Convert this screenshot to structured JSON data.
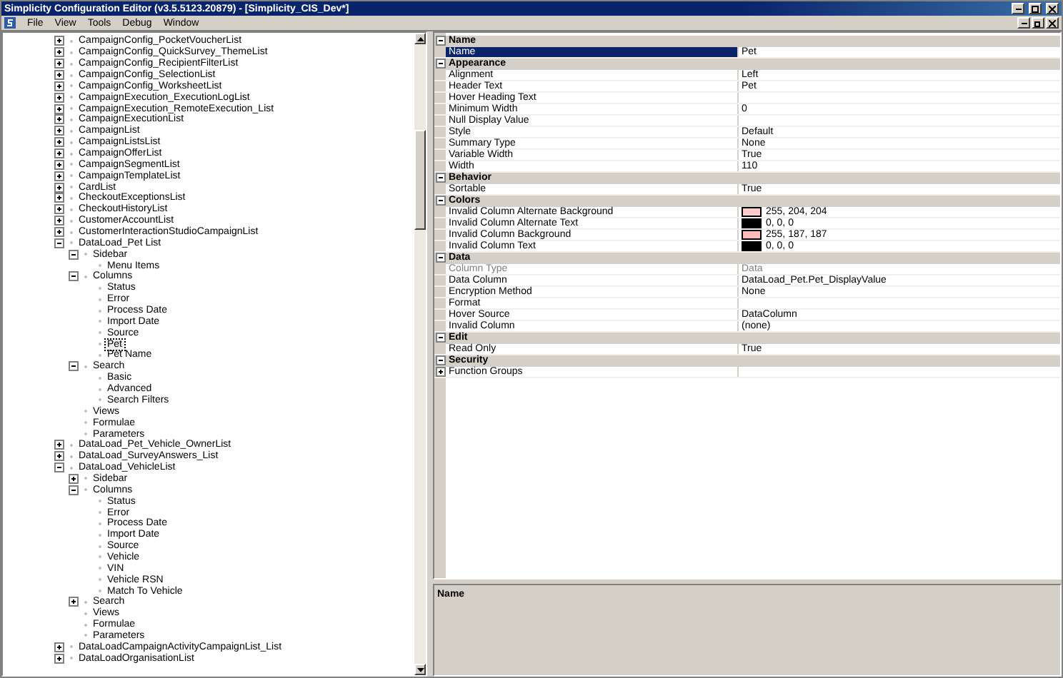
{
  "window": {
    "title": "Simplicity Configuration Editor (v3.5.5123.20879) - [Simplicity_CIS_Dev*]"
  },
  "menu": [
    "File",
    "View",
    "Tools",
    "Debug",
    "Window"
  ],
  "tree": [
    {
      "label": "CampaignConfig_PocketVoucherList",
      "selected": false,
      "expanded": false
    },
    {
      "label": "CampaignConfig_QuickSurvey_ThemeList",
      "selected": false,
      "expanded": false
    },
    {
      "label": "CampaignConfig_RecipientFilterList",
      "selected": false,
      "expanded": false
    },
    {
      "label": "CampaignConfig_SelectionList",
      "selected": false,
      "expanded": false
    },
    {
      "label": "CampaignConfig_WorksheetList",
      "selected": false,
      "expanded": false
    },
    {
      "label": "CampaignExecution_ExecutionLogList",
      "selected": false,
      "expanded": false
    },
    {
      "label": "CampaignExecution_RemoteExecution_List",
      "selected": false,
      "expanded": false
    },
    {
      "label": "CampaignExecutionList",
      "selected": false,
      "expanded": false
    },
    {
      "label": "CampaignList",
      "selected": false,
      "expanded": false
    },
    {
      "label": "CampaignListsList",
      "selected": false,
      "expanded": false
    },
    {
      "label": "CampaignOfferList",
      "selected": false,
      "expanded": false
    },
    {
      "label": "CampaignSegmentList",
      "selected": false,
      "expanded": false
    },
    {
      "label": "CampaignTemplateList",
      "selected": false,
      "expanded": false
    },
    {
      "label": "CardList",
      "selected": false,
      "expanded": false
    },
    {
      "label": "CheckoutExceptionsList",
      "selected": false,
      "expanded": false
    },
    {
      "label": "CheckoutHistoryList",
      "selected": false,
      "expanded": false
    },
    {
      "label": "CustomerAccountList",
      "selected": false,
      "expanded": false
    },
    {
      "label": "CustomerInteractionStudioCampaignList",
      "selected": false,
      "expanded": false
    },
    {
      "label": "DataLoad_Pet List",
      "selected": false,
      "expanded": true,
      "children": [
        {
          "label": "Sidebar",
          "selected": false,
          "expanded": true,
          "children": [
            {
              "label": "Menu Items",
              "selected": false
            }
          ]
        },
        {
          "label": "Columns",
          "selected": false,
          "expanded": true,
          "children": [
            {
              "label": "Status",
              "selected": false
            },
            {
              "label": "Error",
              "selected": false
            },
            {
              "label": "Process Date",
              "selected": false
            },
            {
              "label": "Import Date",
              "selected": false
            },
            {
              "label": "Source",
              "selected": false
            },
            {
              "label": "Pet",
              "selected": true
            },
            {
              "label": "Pet Name",
              "selected": false
            }
          ]
        },
        {
          "label": "Search",
          "selected": false,
          "expanded": true,
          "children": [
            {
              "label": "Basic",
              "selected": false
            },
            {
              "label": "Advanced",
              "selected": false
            },
            {
              "label": "Search Filters",
              "selected": false
            }
          ]
        },
        {
          "label": "Views",
          "selected": false
        },
        {
          "label": "Formulae",
          "selected": false
        },
        {
          "label": "Parameters",
          "selected": false
        }
      ]
    },
    {
      "label": "DataLoad_Pet_Vehicle_OwnerList",
      "selected": false,
      "expanded": false
    },
    {
      "label": "DataLoad_SurveyAnswers_List",
      "selected": false,
      "expanded": false
    },
    {
      "label": "DataLoad_VehicleList",
      "selected": false,
      "expanded": true,
      "children": [
        {
          "label": "Sidebar",
          "selected": false,
          "expanded": false
        },
        {
          "label": "Columns",
          "selected": false,
          "expanded": true,
          "children": [
            {
              "label": "Status",
              "selected": false
            },
            {
              "label": "Error",
              "selected": false
            },
            {
              "label": "Process Date",
              "selected": false
            },
            {
              "label": "Import Date",
              "selected": false
            },
            {
              "label": "Source",
              "selected": false
            },
            {
              "label": "Vehicle",
              "selected": false
            },
            {
              "label": "VIN",
              "selected": false
            },
            {
              "label": "Vehicle RSN",
              "selected": false
            },
            {
              "label": "Match To Vehicle",
              "selected": false
            }
          ]
        },
        {
          "label": "Search",
          "selected": false,
          "expanded": false
        },
        {
          "label": "Views",
          "selected": false
        },
        {
          "label": "Formulae",
          "selected": false
        },
        {
          "label": "Parameters",
          "selected": false
        }
      ]
    },
    {
      "label": "DataLoadCampaignActivityCampaignList_List",
      "selected": false,
      "expanded": false
    },
    {
      "label": "DataLoadOrganisationList",
      "selected": false,
      "expanded": false
    }
  ],
  "properties": [
    {
      "category": "Name",
      "expanded": true,
      "rows": [
        {
          "kind": "value",
          "name": "Name",
          "value": "Pet",
          "selected": true,
          "disabled": false
        }
      ]
    },
    {
      "category": "Appearance",
      "expanded": true,
      "rows": [
        {
          "kind": "value",
          "name": "Alignment",
          "value": "Left",
          "selected": false,
          "disabled": false
        },
        {
          "kind": "value",
          "name": "Header Text",
          "value": "Pet",
          "selected": false,
          "disabled": false
        },
        {
          "kind": "value",
          "name": "Hover Heading Text",
          "selected": false,
          "disabled": false
        },
        {
          "kind": "value",
          "name": "Minimum Width",
          "value": "0",
          "selected": false,
          "disabled": false
        },
        {
          "kind": "value",
          "name": "Null Display Value",
          "selected": false,
          "disabled": false
        },
        {
          "kind": "value",
          "name": "Style",
          "value": "Default",
          "selected": false,
          "disabled": false
        },
        {
          "kind": "value",
          "name": "Summary Type",
          "value": "None",
          "selected": false,
          "disabled": false
        },
        {
          "kind": "value",
          "name": "Variable Width",
          "value": "True",
          "selected": false,
          "disabled": false
        },
        {
          "kind": "value",
          "name": "Width",
          "value": "110",
          "selected": false,
          "disabled": false
        }
      ]
    },
    {
      "category": "Behavior",
      "expanded": true,
      "rows": [
        {
          "kind": "value",
          "name": "Sortable",
          "value": "True",
          "selected": false,
          "disabled": false
        }
      ]
    },
    {
      "category": "Colors",
      "expanded": true,
      "rows": [
        {
          "kind": "color",
          "name": "Invalid Column Alternate Background",
          "value": "255, 204, 204",
          "color": "#ffcccc",
          "selected": false,
          "disabled": false
        },
        {
          "kind": "color",
          "name": "Invalid Column Alternate Text",
          "value": "0, 0, 0",
          "color": "#000000",
          "selected": false,
          "disabled": false
        },
        {
          "kind": "color",
          "name": "Invalid Column Background",
          "value": "255, 187, 187",
          "color": "#ffbbbb",
          "selected": false,
          "disabled": false
        },
        {
          "kind": "color",
          "name": "Invalid Column Text",
          "value": "0, 0, 0",
          "color": "#000000",
          "selected": false,
          "disabled": false
        }
      ]
    },
    {
      "category": "Data",
      "expanded": true,
      "rows": [
        {
          "kind": "value",
          "name": "Column Type",
          "value": "Data",
          "selected": false,
          "disabled": true
        },
        {
          "kind": "value",
          "name": "Data Column",
          "value": "DataLoad_Pet.Pet_DisplayValue",
          "selected": false,
          "disabled": false
        },
        {
          "kind": "value",
          "name": "Encryption Method",
          "value": "None",
          "selected": false,
          "disabled": false
        },
        {
          "kind": "value",
          "name": "Format",
          "selected": false,
          "disabled": false
        },
        {
          "kind": "value",
          "name": "Hover Source",
          "value": "DataColumn",
          "selected": false,
          "disabled": false
        },
        {
          "kind": "value",
          "name": "Invalid Column",
          "value": "(none)",
          "selected": false,
          "disabled": false
        }
      ]
    },
    {
      "category": "Edit",
      "expanded": true,
      "rows": [
        {
          "kind": "value",
          "name": "Read Only",
          "value": "True",
          "selected": false,
          "disabled": false
        }
      ]
    },
    {
      "category": "Security",
      "expanded": true,
      "rows": [
        {
          "kind": "group",
          "name": "Function Groups",
          "expanded": false,
          "selected": false,
          "disabled": false
        }
      ]
    }
  ],
  "description": {
    "title": "Name"
  }
}
